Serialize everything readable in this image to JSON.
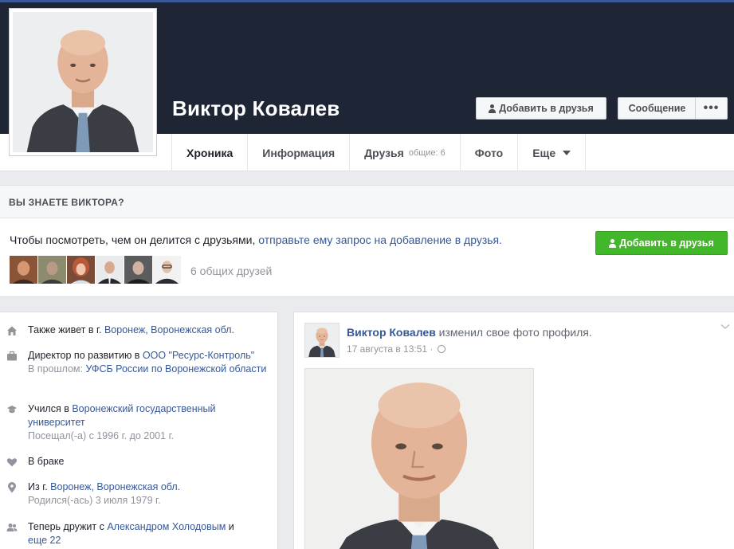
{
  "profile": {
    "name": "Виктор Ковалев"
  },
  "actions": {
    "add_friend": "Добавить в друзья",
    "message": "Сообщение",
    "more": "•••"
  },
  "tabs": [
    {
      "label": "Хроника",
      "extra": "",
      "active": true
    },
    {
      "label": "Информация",
      "extra": ""
    },
    {
      "label": "Друзья",
      "extra": "общие: 6"
    },
    {
      "label": "Фото",
      "extra": ""
    },
    {
      "label": "Еще",
      "extra": ""
    }
  ],
  "know_box": {
    "title": "ВЫ ЗНАЕТЕ ВИКТОРА?",
    "text_before": "Чтобы посмотреть, чем он делится с друзьями, ",
    "text_link": "отправьте ему запрос на добавление в друзья.",
    "add_button": "Добавить в друзья",
    "mutual_friends": "6 общих друзей",
    "friend_thumbs": 6
  },
  "intro": [
    {
      "icon": "house-icon",
      "prefix": "Также живет в г. ",
      "link": "Воронеж, Воронежская обл.",
      "suffix": "",
      "sub_prefix": "",
      "sub_link": "",
      "sub_suffix": ""
    },
    {
      "icon": "briefcase-icon",
      "prefix": "Директор по развитию в ",
      "link": "ООО \"Ресурс-Контроль\"",
      "suffix": "",
      "sub_prefix": "В прошлом: ",
      "sub_link": "УФСБ России по Воронежской области",
      "sub_suffix": ""
    },
    {
      "icon": "graduation-cap-icon",
      "prefix": "Учился в ",
      "link": "Воронежский государственный университет",
      "suffix": "",
      "sub_prefix": "Посещал(-а) с 1996 г. до 2001 г.",
      "sub_link": "",
      "sub_suffix": ""
    },
    {
      "icon": "heart-icon",
      "prefix": "В браке",
      "link": "",
      "suffix": "",
      "sub_prefix": "",
      "sub_link": "",
      "sub_suffix": ""
    },
    {
      "icon": "location-pin-icon",
      "prefix": "Из г. ",
      "link": "Воронеж, Воронежская обл.",
      "suffix": "",
      "sub_prefix": "Родился(-ась) ",
      "sub_link": "3 июля 1979 г.",
      "sub_suffix": ""
    },
    {
      "icon": "friends-icon",
      "prefix": "Теперь дружит с ",
      "link": "Александром Холодовым",
      "suffix": " и",
      "sub_prefix": "",
      "sub_link": "еще 22",
      "sub_suffix": ""
    }
  ],
  "post": {
    "author": "Виктор Ковалев",
    "action": " изменил свое фото профиля.",
    "time": "17 августа в 13:51 ·"
  },
  "colors": {
    "cover": "#1e2635",
    "link": "#365899",
    "green": "#42b72a",
    "top_bar": "#3b5998"
  }
}
